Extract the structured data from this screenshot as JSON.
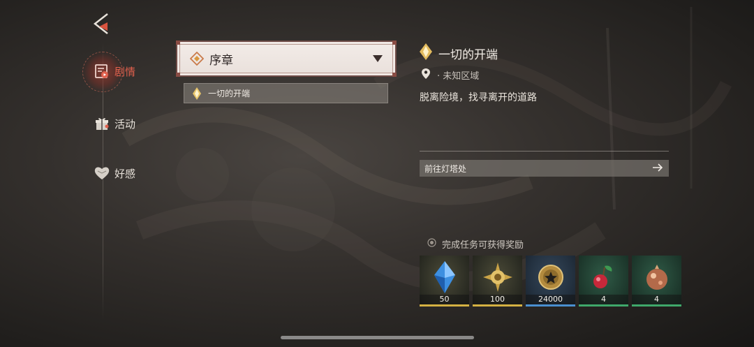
{
  "sidebar": {
    "items": [
      {
        "label": "剧情",
        "icon": "story-icon",
        "active": true
      },
      {
        "label": "活动",
        "icon": "gift-icon",
        "active": false
      },
      {
        "label": "好感",
        "icon": "heart-icon",
        "active": false
      }
    ]
  },
  "chapter": {
    "selected": "序章"
  },
  "quest_list": [
    {
      "label": "一切的开端"
    }
  ],
  "detail": {
    "title": "一切的开端",
    "location": "· 未知区域",
    "description": "脱离险境，找寻离开的道路",
    "action_label": "前往灯塔处"
  },
  "rewards": {
    "title": "完成任务可获得奖励",
    "items": [
      {
        "count": "50",
        "icon": "blue-crystal-icon",
        "rarity_color": "#d4b142"
      },
      {
        "count": "100",
        "icon": "gold-star-orb-icon",
        "rarity_color": "#d4b142"
      },
      {
        "count": "24000",
        "icon": "gold-coin-icon",
        "rarity_color": "#4a8fd0"
      },
      {
        "count": "4",
        "icon": "red-berry-icon",
        "rarity_color": "#3fa86a"
      },
      {
        "count": "4",
        "icon": "copper-orb-icon",
        "rarity_color": "#3fa86a"
      }
    ]
  },
  "colors": {
    "accent": "#e0604d",
    "panel_bg": "#f1e9e5"
  }
}
